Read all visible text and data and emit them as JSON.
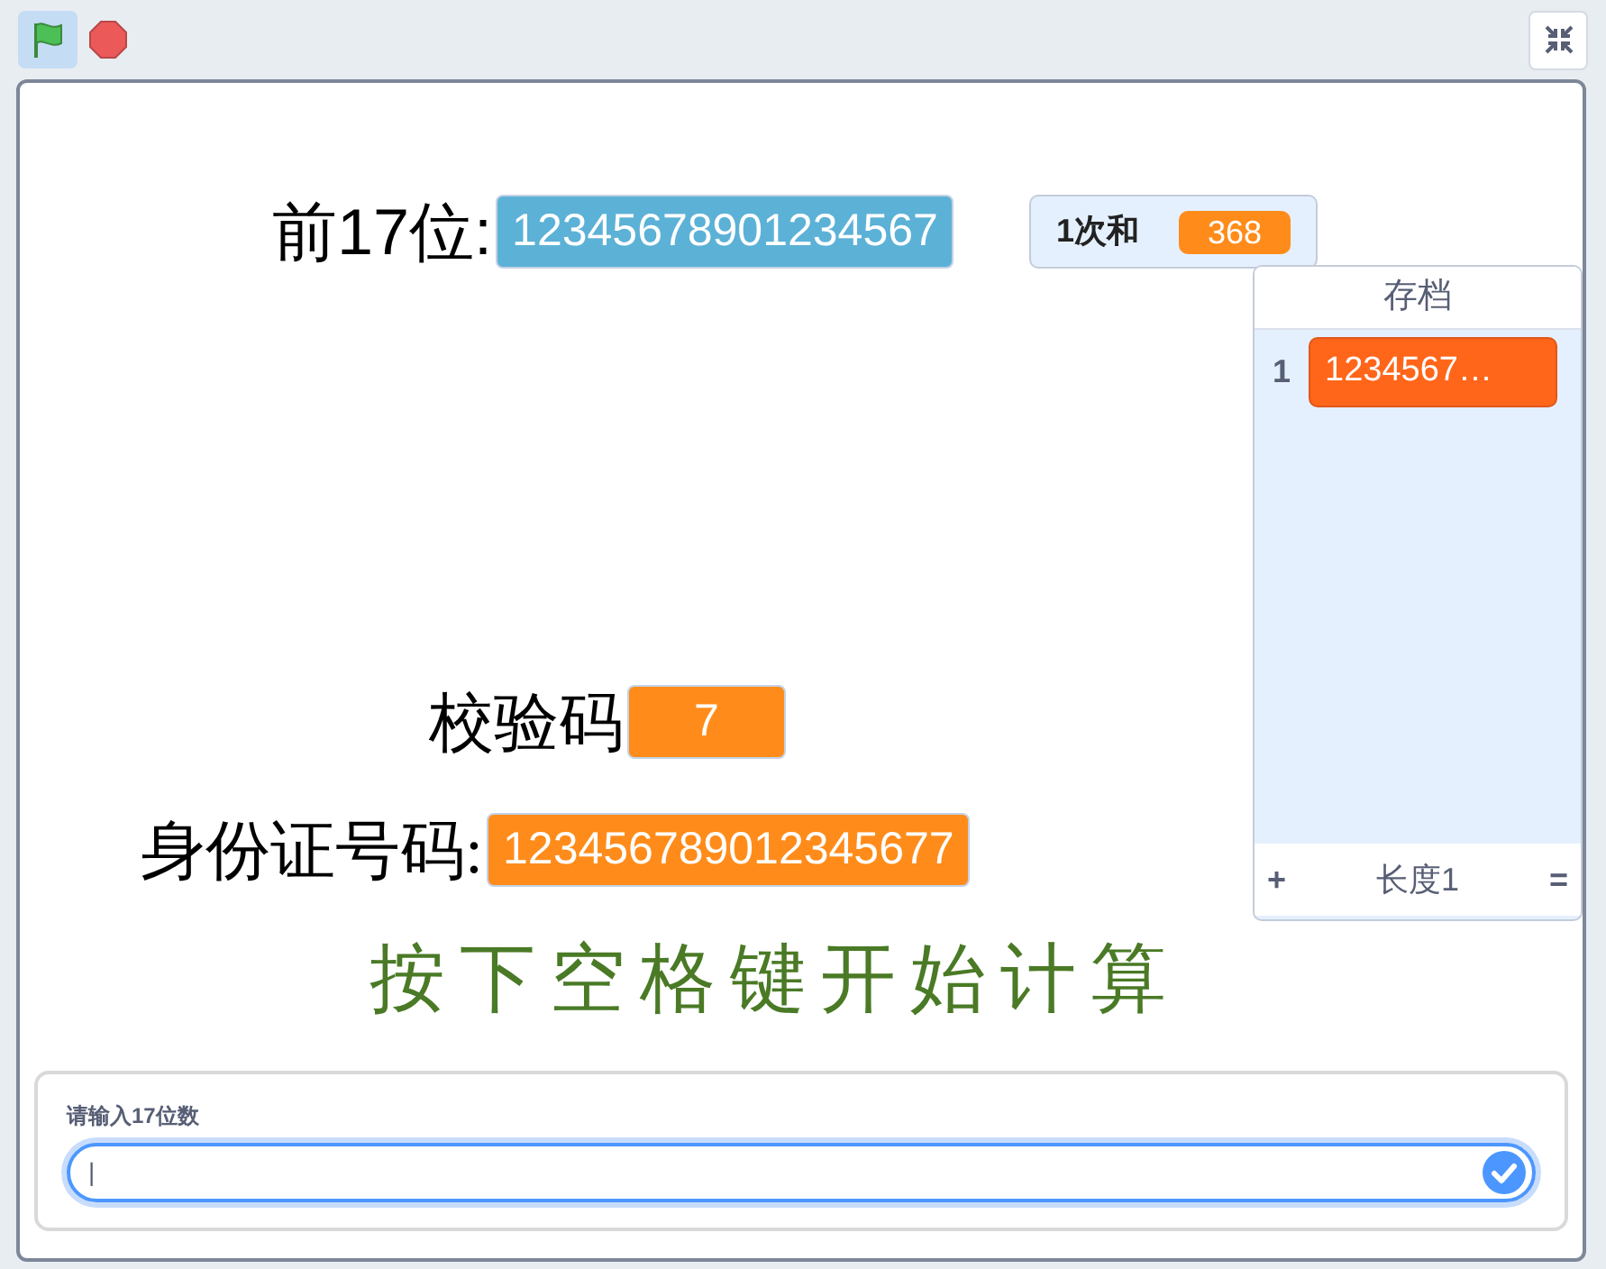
{
  "toolbar": {
    "green_flag": {
      "selected": true
    }
  },
  "stage": {
    "variables": [
      {
        "kind": "large",
        "label": "前17位:",
        "value": "12345678901234567",
        "color": "#5cb1d6"
      },
      {
        "kind": "normal",
        "label": "1次和",
        "value": "368",
        "color": "#ff8c1a"
      },
      {
        "kind": "large_serif",
        "label": "校验码",
        "value": "7",
        "color": "#ff8c1a"
      },
      {
        "kind": "large_serif",
        "label": "身份证号码:",
        "value": "123456789012345677",
        "color": "#ff8c1a"
      }
    ],
    "list": {
      "title": "存档",
      "items": [
        {
          "index": "1",
          "value": "1234567…"
        }
      ],
      "add": "+",
      "length": "长度1",
      "resize": "="
    },
    "messages": [
      "按下空格键开始计算"
    ],
    "prompt": {
      "question": "请输入17位数",
      "value": "|"
    }
  }
}
